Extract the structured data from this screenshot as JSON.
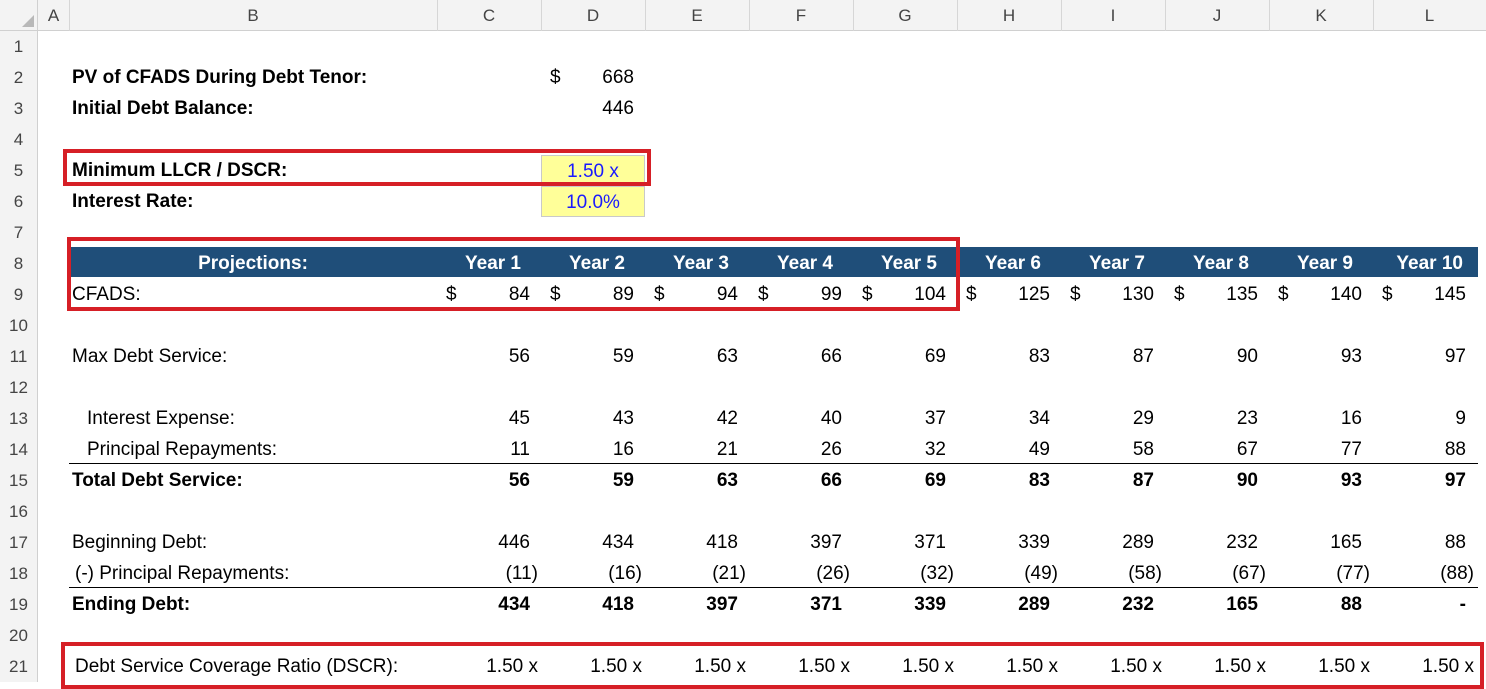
{
  "columns": [
    "A",
    "B",
    "C",
    "D",
    "E",
    "F",
    "G",
    "H",
    "I",
    "J",
    "K",
    "L"
  ],
  "rows": [
    "1",
    "2",
    "3",
    "4",
    "5",
    "6",
    "7",
    "8",
    "9",
    "10",
    "11",
    "12",
    "13",
    "14",
    "15",
    "16",
    "17",
    "18",
    "19",
    "20",
    "21"
  ],
  "summary": {
    "pv_label": "PV of CFADS During Debt Tenor:",
    "pv_currency": "$",
    "pv_value": "668",
    "initial_debt_label": "Initial Debt Balance:",
    "initial_debt_value": "446",
    "min_llcr_label": "Minimum LLCR / DSCR:",
    "min_llcr_value": "1.50 x",
    "interest_rate_label": "Interest Rate:",
    "interest_rate_value": "10.0%"
  },
  "projections": {
    "header_label": "Projections:",
    "years": [
      "Year 1",
      "Year 2",
      "Year 3",
      "Year 4",
      "Year 5",
      "Year 6",
      "Year 7",
      "Year 8",
      "Year 9",
      "Year 10"
    ],
    "cfads_label": "CFADS:",
    "currency": "$",
    "cfads": [
      "84",
      "89",
      "94",
      "99",
      "104",
      "125",
      "130",
      "135",
      "140",
      "145"
    ],
    "max_debt_service_label": "Max Debt Service:",
    "max_debt_service": [
      "56",
      "59",
      "63",
      "66",
      "69",
      "83",
      "87",
      "90",
      "93",
      "97"
    ],
    "interest_expense_label": "Interest Expense:",
    "interest_expense": [
      "45",
      "43",
      "42",
      "40",
      "37",
      "34",
      "29",
      "23",
      "16",
      "9"
    ],
    "principal_repayments_label": "Principal Repayments:",
    "principal_repayments": [
      "11",
      "16",
      "21",
      "26",
      "32",
      "49",
      "58",
      "67",
      "77",
      "88"
    ],
    "total_debt_service_label": "Total Debt Service:",
    "total_debt_service": [
      "56",
      "59",
      "63",
      "66",
      "69",
      "83",
      "87",
      "90",
      "93",
      "97"
    ],
    "beginning_debt_label": "Beginning Debt:",
    "beginning_debt": [
      "446",
      "434",
      "418",
      "397",
      "371",
      "339",
      "289",
      "232",
      "165",
      "88"
    ],
    "less_principal_label": "(-) Principal Repayments:",
    "less_principal": [
      "(11)",
      "(16)",
      "(21)",
      "(26)",
      "(32)",
      "(49)",
      "(58)",
      "(67)",
      "(77)",
      "(88)"
    ],
    "ending_debt_label": "Ending Debt:",
    "ending_debt": [
      "434",
      "418",
      "397",
      "371",
      "339",
      "289",
      "232",
      "165",
      "88",
      "-"
    ],
    "dscr_label": "Debt Service Coverage Ratio (DSCR):",
    "dscr": [
      "1.50 x",
      "1.50 x",
      "1.50 x",
      "1.50 x",
      "1.50 x",
      "1.50 x",
      "1.50 x",
      "1.50 x",
      "1.50 x",
      "1.50 x"
    ]
  },
  "colors": {
    "header_bar": "#1f4e79",
    "highlight_red": "#d61f26",
    "input_yellow": "#ffff99",
    "input_blue": "#1a1aff"
  }
}
